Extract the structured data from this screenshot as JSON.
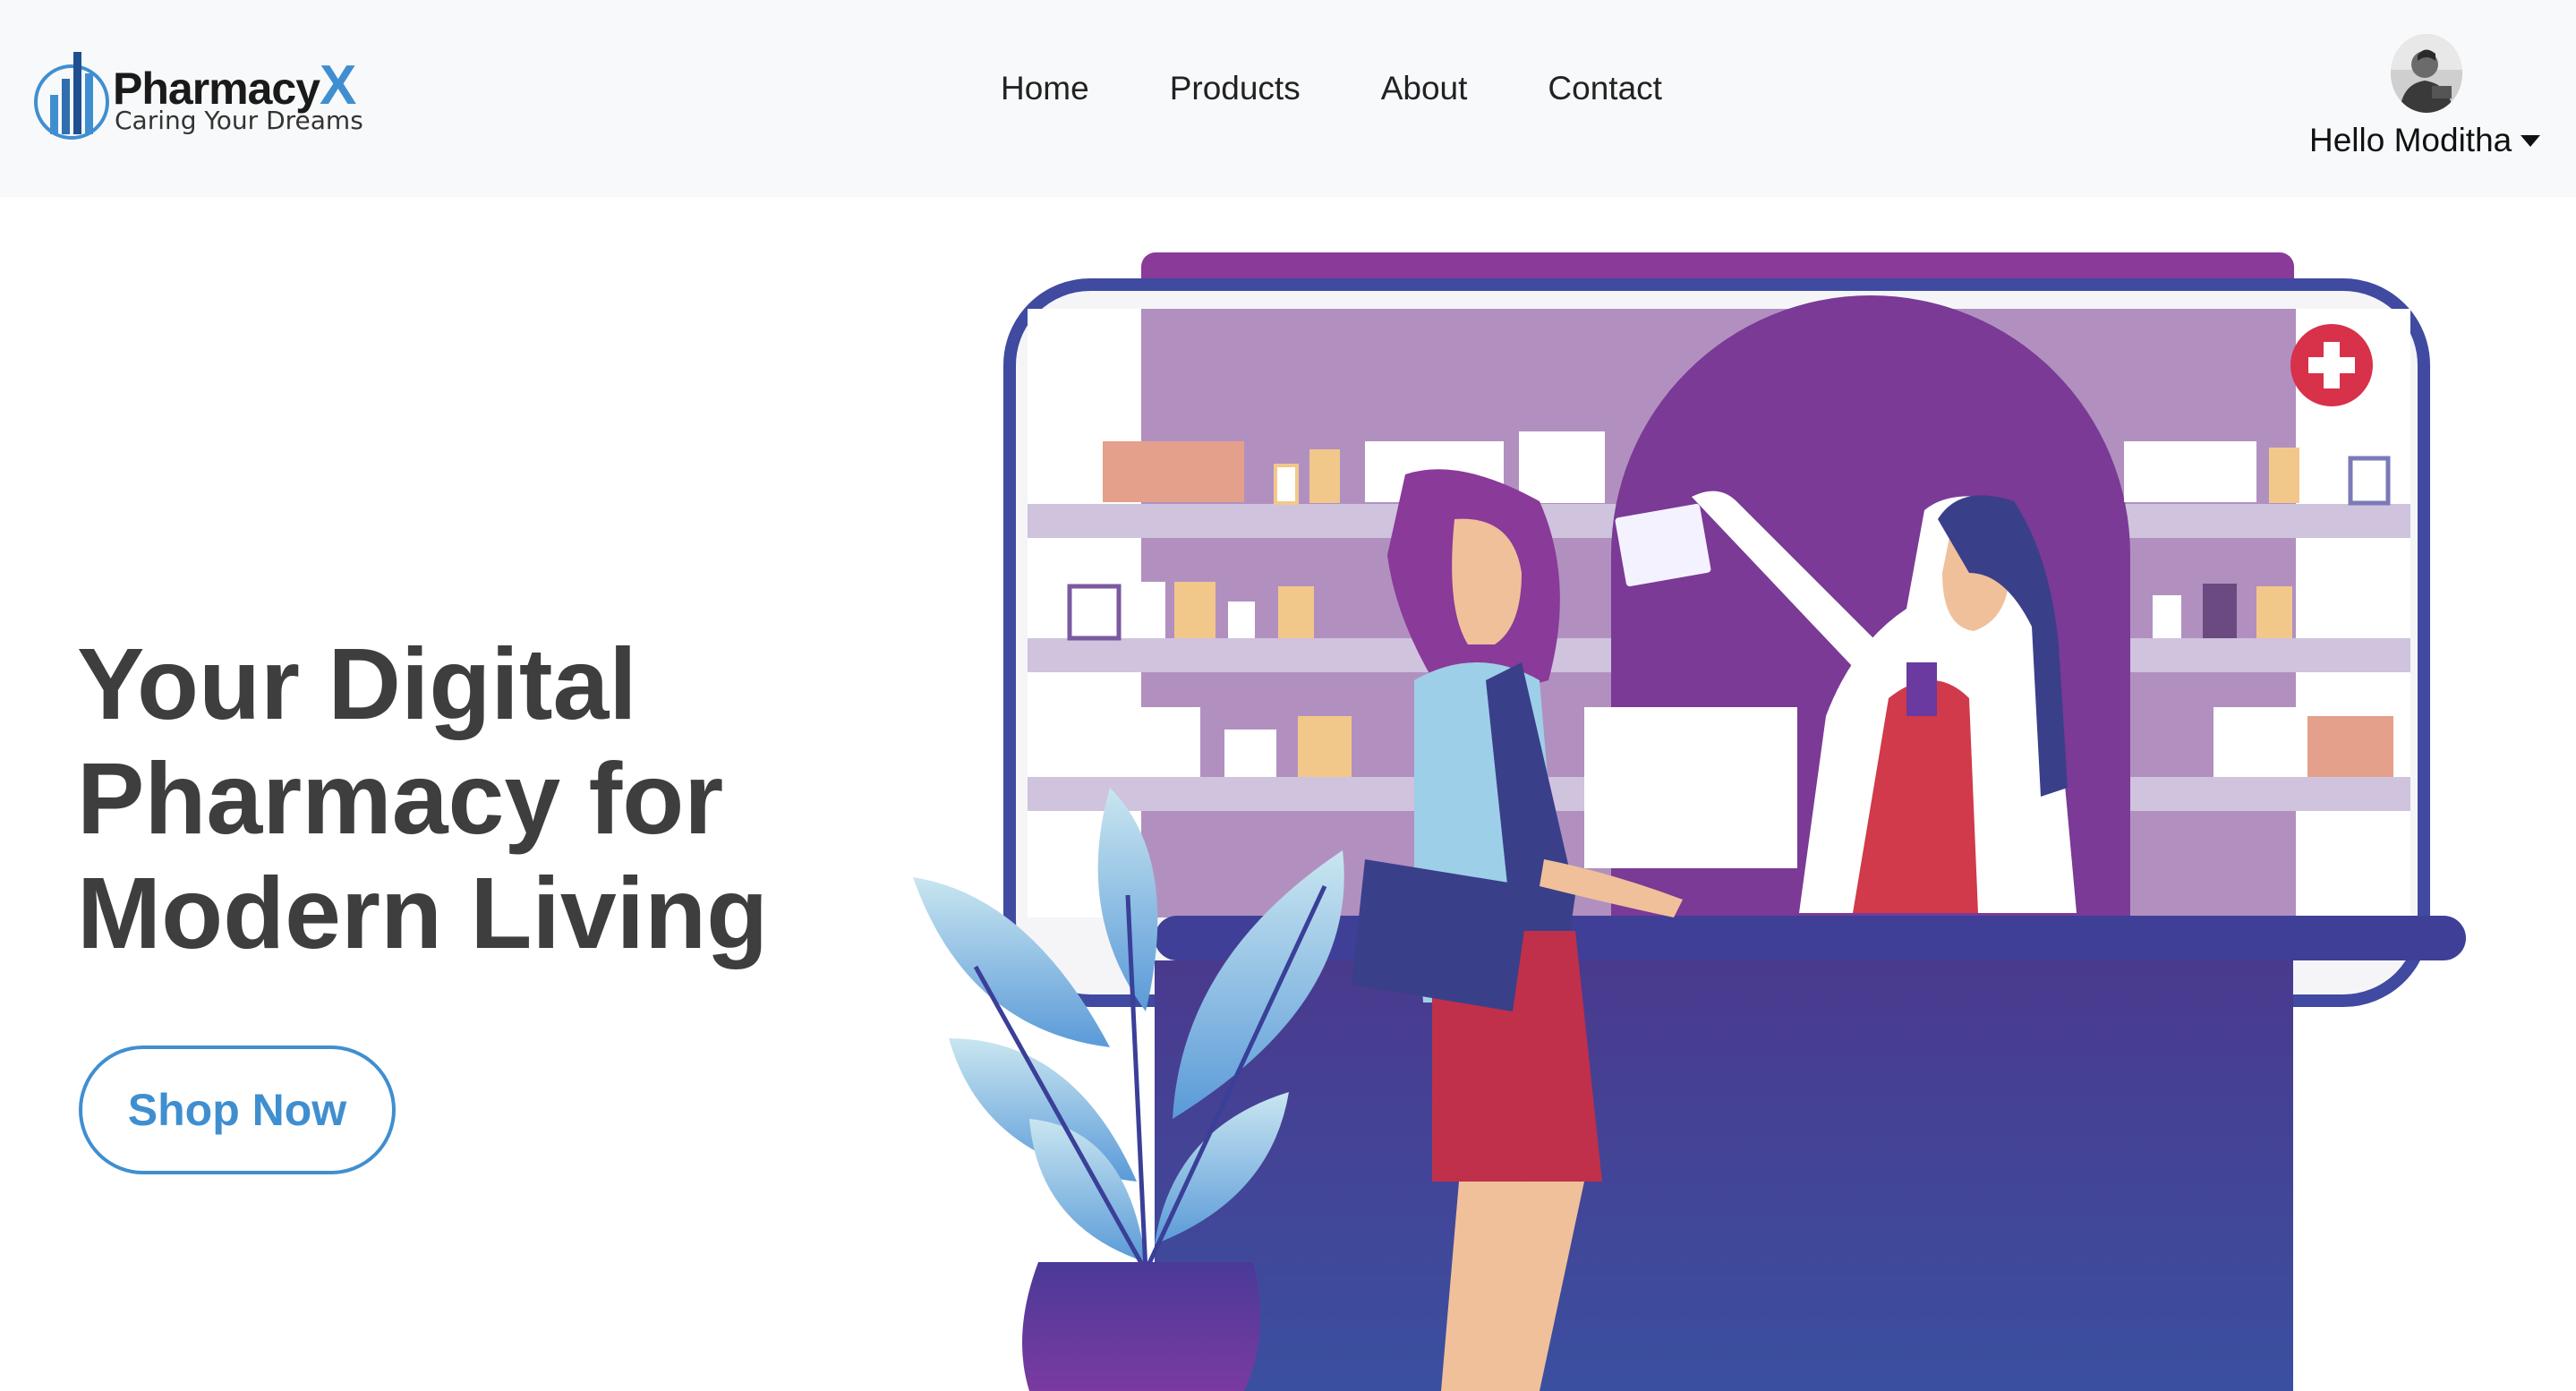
{
  "brand": {
    "name": "Pharmacy",
    "name_suffix": "X",
    "tagline": "Caring Your Dreams"
  },
  "nav": {
    "items": [
      {
        "label": "Home"
      },
      {
        "label": "Products"
      },
      {
        "label": "About"
      },
      {
        "label": "Contact"
      }
    ]
  },
  "user": {
    "greeting": "Hello Moditha",
    "avatar_icon": "user-avatar-photo",
    "menu_icon": "caret-down-icon"
  },
  "hero": {
    "title": "Your Digital Pharmacy for Modern Living",
    "cta_label": "Shop Now",
    "illustration": "pharmacist-handing-prescription-to-customer"
  },
  "colors": {
    "accent": "#3f8fd0",
    "heading": "#3e3e3e",
    "navbar_bg": "#f8f9fa",
    "illustration_purple": "#6a3d9a",
    "illustration_navy": "#3e4a9a"
  }
}
